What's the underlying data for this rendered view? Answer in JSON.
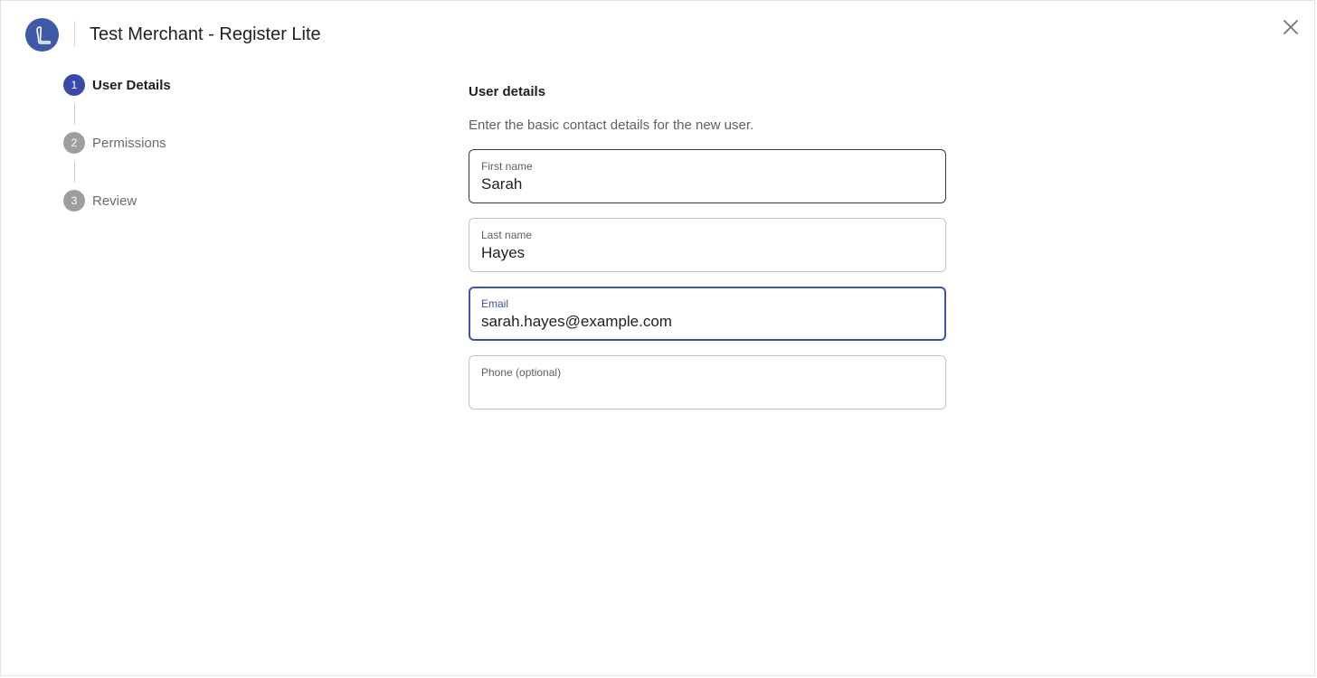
{
  "header": {
    "title": "Test Merchant - Register Lite",
    "logo_icon": "brand-logo-icon",
    "logo_color": "#3f5aa7",
    "close_icon": "close-icon"
  },
  "stepper": {
    "steps": [
      {
        "number": "1",
        "label": "User Details",
        "state": "active"
      },
      {
        "number": "2",
        "label": "Permissions",
        "state": "inactive"
      },
      {
        "number": "3",
        "label": "Review",
        "state": "inactive"
      }
    ],
    "active_color": "#3949ab",
    "inactive_color": "#9e9e9e"
  },
  "form": {
    "title": "User details",
    "description": "Enter the basic contact details for the new user.",
    "fields": [
      {
        "label": "First name",
        "value": "Sarah",
        "placeholder": ""
      },
      {
        "label": "Last name",
        "value": "Hayes",
        "placeholder": ""
      },
      {
        "label": "Email",
        "value": "sarah.hayes@example.com",
        "placeholder": ""
      },
      {
        "label": "Phone (optional)",
        "value": "",
        "placeholder": ""
      }
    ],
    "focus_color": "#3f51a8"
  }
}
